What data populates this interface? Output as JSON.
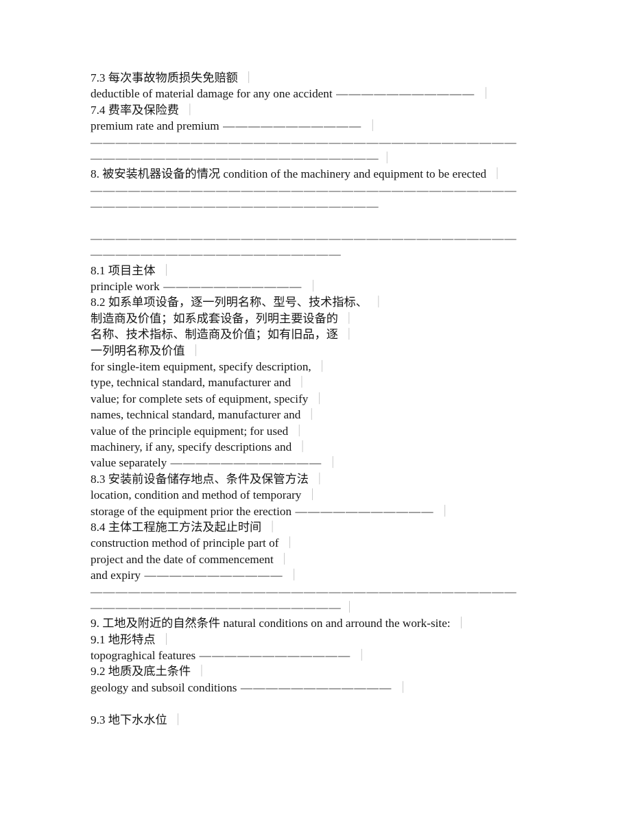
{
  "document": {
    "type": "contract-form",
    "page_background": "#ffffff",
    "text_color": "#161616",
    "field_bar_color": "#b4b4b4",
    "bar_glyph": "｜",
    "leader_glyph": "—",
    "lines": [
      {
        "id": "l1",
        "kind": "text",
        "content": "7.3 每次事故物质损失免赔额",
        "leader": "",
        "bar": true
      },
      {
        "id": "l2",
        "kind": "text",
        "content": "deductible of material damage for any one accident",
        "leader": " ———————————",
        "bar": true
      },
      {
        "id": "l3",
        "kind": "text",
        "content": "7.4 费率及保险费",
        "leader": "",
        "bar": true
      },
      {
        "id": "l4",
        "kind": "text",
        "content": "premium rate and premium",
        "leader": " ———————————",
        "bar": true
      },
      {
        "id": "l5",
        "kind": "sep",
        "content": "——————————————————————————————————",
        "bar": false
      },
      {
        "id": "l6",
        "kind": "sep",
        "content": "———————————————————————",
        "bar": true
      },
      {
        "id": "l7",
        "kind": "text",
        "content": "8. 被安装机器设备的情况 condition of the machinery and equipment to be erected",
        "leader": "",
        "bar": true
      },
      {
        "id": "l8",
        "kind": "sep",
        "content": "——————————————————————————————————",
        "bar": false
      },
      {
        "id": "l9",
        "kind": "sep",
        "content": "———————————————————————",
        "bar": false
      },
      {
        "id": "l10",
        "kind": "blank",
        "content": "",
        "bar": false
      },
      {
        "id": "l11",
        "kind": "sep",
        "content": "——————————————————————————————————",
        "bar": false
      },
      {
        "id": "l12",
        "kind": "sep",
        "content": "————————————————————",
        "bar": false
      },
      {
        "id": "l13",
        "kind": "text",
        "content": "8.1 项目主体",
        "leader": "",
        "bar": true
      },
      {
        "id": "l14",
        "kind": "text",
        "content": "principle work",
        "leader": " ———————————",
        "bar": true
      },
      {
        "id": "l15",
        "kind": "text",
        "content": "8.2 如系单项设备，逐一列明名称、型号、技术指标、",
        "leader": "",
        "bar": true
      },
      {
        "id": "l16",
        "kind": "text",
        "content": "制造商及价值；如系成套设备，列明主要设备的",
        "leader": "",
        "bar": true
      },
      {
        "id": "l17",
        "kind": "text",
        "content": "名称、技术指标、制造商及价值；如有旧品，逐",
        "leader": "",
        "bar": true
      },
      {
        "id": "l18",
        "kind": "text",
        "content": "一列明名称及价值",
        "leader": "",
        "bar": true
      },
      {
        "id": "l19",
        "kind": "text",
        "content": "for single-item equipment, specify description,",
        "leader": "",
        "bar": true
      },
      {
        "id": "l20",
        "kind": "text",
        "content": "type, technical standard, manufacturer and",
        "leader": "",
        "bar": true
      },
      {
        "id": "l21",
        "kind": "text",
        "content": "value; for complete sets of equipment, specify",
        "leader": "",
        "bar": true
      },
      {
        "id": "l22",
        "kind": "text",
        "content": "names, technical standard, manufacturer and",
        "leader": "",
        "bar": true
      },
      {
        "id": "l23",
        "kind": "text",
        "content": "value of the principle equipment; for used",
        "leader": "",
        "bar": true
      },
      {
        "id": "l24",
        "kind": "text",
        "content": "machinery, if any, specify descriptions and",
        "leader": "",
        "bar": true
      },
      {
        "id": "l25",
        "kind": "text",
        "content": "value separately",
        "leader": " ————————————",
        "bar": true
      },
      {
        "id": "l26",
        "kind": "text",
        "content": "8.3 安装前设备储存地点、条件及保管方法",
        "leader": "",
        "bar": true
      },
      {
        "id": "l27",
        "kind": "text",
        "content": "location, condition and method of temporary",
        "leader": "",
        "bar": true
      },
      {
        "id": "l28",
        "kind": "text",
        "content": "storage of the equipment prior the erection",
        "leader": " ———————————",
        "bar": true
      },
      {
        "id": "l29",
        "kind": "text",
        "content": "8.4 主体工程施工方法及起止时间",
        "leader": "",
        "bar": true
      },
      {
        "id": "l30",
        "kind": "text",
        "content": "construction method of principle part of",
        "leader": "",
        "bar": true
      },
      {
        "id": "l31",
        "kind": "text",
        "content": "project and the date of commencement",
        "leader": "",
        "bar": true
      },
      {
        "id": "l32",
        "kind": "text",
        "content": "and expiry",
        "leader": " ———————————",
        "bar": true
      },
      {
        "id": "l33",
        "kind": "sep",
        "content": "——————————————————————————————————",
        "bar": false
      },
      {
        "id": "l34",
        "kind": "sep",
        "content": "————————————————————",
        "bar": true
      },
      {
        "id": "l35",
        "kind": "text",
        "content": "9. 工地及附近的自然条件 natural conditions on and arround the work-site:",
        "leader": "",
        "bar": true
      },
      {
        "id": "l36",
        "kind": "text",
        "content": "9.1 地形特点",
        "leader": "",
        "bar": true
      },
      {
        "id": "l37",
        "kind": "text",
        "content": "topograghical features",
        "leader": " ————————————",
        "bar": true
      },
      {
        "id": "l38",
        "kind": "text",
        "content": "9.2 地质及底土条件",
        "leader": "",
        "bar": true
      },
      {
        "id": "l39",
        "kind": "text",
        "content": "geology and subsoil conditions",
        "leader": " ————————————",
        "bar": true
      },
      {
        "id": "l40",
        "kind": "blank",
        "content": "",
        "bar": false
      },
      {
        "id": "l41",
        "kind": "text",
        "content": "9.3 地下水水位",
        "leader": "",
        "bar": true
      }
    ]
  }
}
